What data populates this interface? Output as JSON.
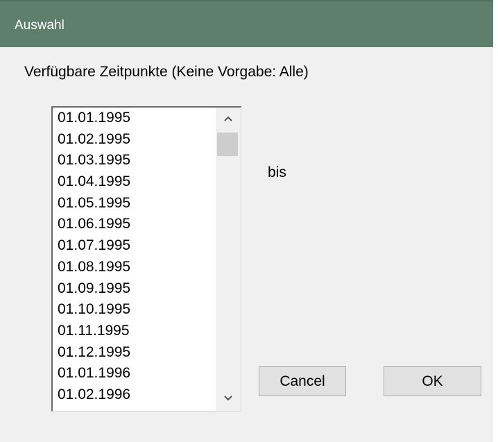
{
  "window": {
    "title": "Auswahl"
  },
  "section_label": "Verfügbare Zeitpunkte (Keine Vorgabe: Alle)",
  "timepoints": [
    "01.01.1995",
    "01.02.1995",
    "01.03.1995",
    "01.04.1995",
    "01.05.1995",
    "01.06.1995",
    "01.07.1995",
    "01.08.1995",
    "01.09.1995",
    "01.10.1995",
    "01.11.1995",
    "01.12.1995",
    "01.01.1996",
    "01.02.1996"
  ],
  "range_separator": "bis",
  "buttons": {
    "cancel": "Cancel",
    "ok": "OK"
  },
  "icons": {
    "scroll_up": "chevron-up-icon",
    "scroll_down": "chevron-down-icon"
  }
}
